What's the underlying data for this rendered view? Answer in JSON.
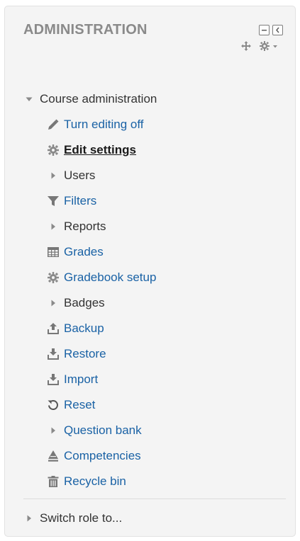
{
  "block": {
    "title": "ADMINISTRATION",
    "controls": {
      "hide_icon": "minus-box-icon",
      "dock_icon": "dock-left-icon",
      "move_icon": "move-arrows-icon",
      "actions_icon": "gear-dropdown-icon"
    }
  },
  "course_admin": {
    "label": "Course administration",
    "expanded": true,
    "items": [
      {
        "label": "Turn editing off",
        "icon": "pencil-icon",
        "type": "link"
      },
      {
        "label": "Edit settings",
        "icon": "gear-icon",
        "type": "active"
      },
      {
        "label": "Users",
        "icon": "expander-right-icon",
        "type": "branch"
      },
      {
        "label": "Filters",
        "icon": "filter-icon",
        "type": "link"
      },
      {
        "label": "Reports",
        "icon": "expander-right-icon",
        "type": "branch"
      },
      {
        "label": "Grades",
        "icon": "table-icon",
        "type": "link"
      },
      {
        "label": "Gradebook setup",
        "icon": "gear-icon",
        "type": "link"
      },
      {
        "label": "Badges",
        "icon": "expander-right-icon",
        "type": "branch"
      },
      {
        "label": "Backup",
        "icon": "upload-icon",
        "type": "link"
      },
      {
        "label": "Restore",
        "icon": "download-icon",
        "type": "link"
      },
      {
        "label": "Import",
        "icon": "download-icon",
        "type": "link"
      },
      {
        "label": "Reset",
        "icon": "reset-icon",
        "type": "link"
      },
      {
        "label": "Question bank",
        "icon": "expander-right-icon",
        "type": "branch-link"
      },
      {
        "label": "Competencies",
        "icon": "competencies-icon",
        "type": "link"
      },
      {
        "label": "Recycle bin",
        "icon": "trash-icon",
        "type": "link"
      }
    ]
  },
  "switch_role": {
    "label": "Switch role to..."
  },
  "colors": {
    "link": "#1a62a5",
    "text": "#333333",
    "title": "#8a8a8a",
    "icon": "#777777",
    "background": "#f4f4f4"
  }
}
